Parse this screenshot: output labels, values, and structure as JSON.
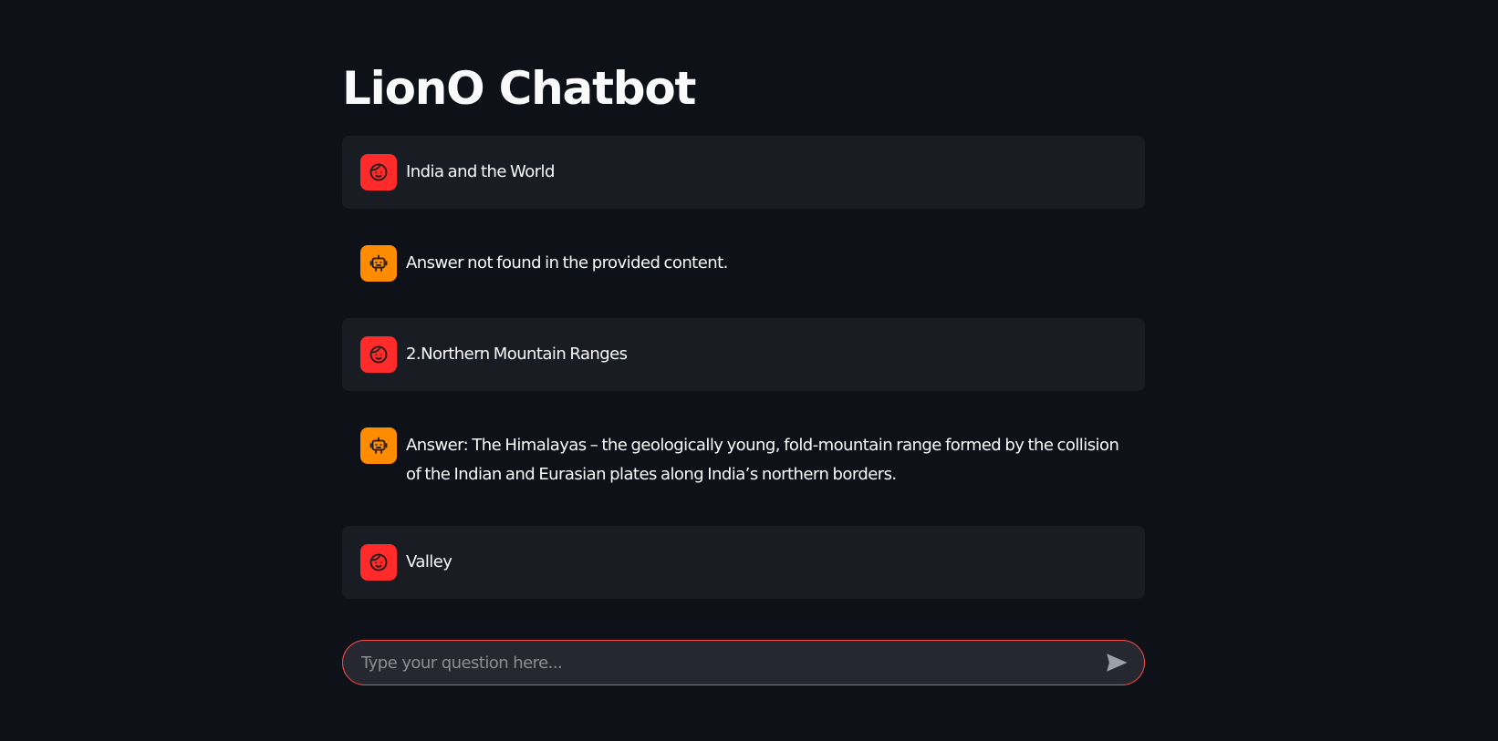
{
  "page": {
    "title": "LionO Chatbot"
  },
  "colors": {
    "background": "#0e1117",
    "user_message_bg": "#1a1c23",
    "user_avatar": "#ff2b2b",
    "assistant_avatar": "#ff8c00",
    "input_border": "#ff4b4b",
    "input_bg": "#262730",
    "text": "#fafafa"
  },
  "messages": [
    {
      "role": "user",
      "avatar_icon": "smiley-face-icon",
      "text": "India and the World"
    },
    {
      "role": "assistant",
      "avatar_icon": "robot-icon",
      "text": "Answer not found in the provided content."
    },
    {
      "role": "user",
      "avatar_icon": "smiley-face-icon",
      "text": "2.Northern Mountain Ranges"
    },
    {
      "role": "assistant",
      "avatar_icon": "robot-icon",
      "text": "Answer: The Himalayas – the geologically young, fold-mountain range formed by the collision of the Indian and Eurasian plates along India’s northern borders."
    },
    {
      "role": "user",
      "avatar_icon": "smiley-face-icon",
      "text": "Valley"
    }
  ],
  "chat_input": {
    "placeholder": "Type your question here...",
    "value": "",
    "send_icon": "send-icon"
  }
}
